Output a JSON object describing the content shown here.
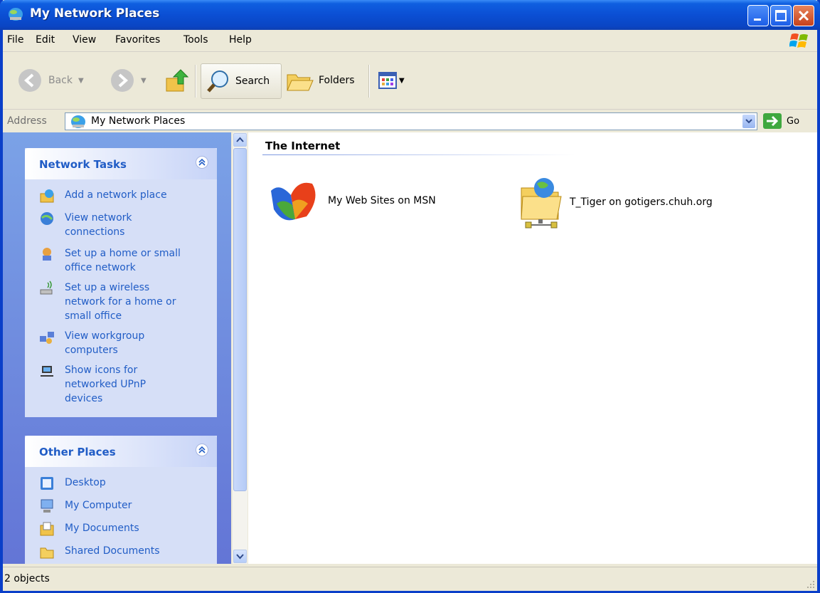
{
  "window": {
    "title": "My Network Places"
  },
  "menu": [
    "File",
    "Edit",
    "View",
    "Favorites",
    "Tools",
    "Help"
  ],
  "toolbar": {
    "back": "Back",
    "search": "Search",
    "folders": "Folders"
  },
  "address": {
    "label": "Address",
    "value": "My Network Places",
    "go": "Go"
  },
  "network_tasks": {
    "title": "Network Tasks",
    "items": [
      {
        "label": "Add a network place",
        "icon": "add-network-place-icon"
      },
      {
        "label": "View network connections",
        "icon": "network-connections-icon"
      },
      {
        "label": "Set up a home or small office network",
        "icon": "home-network-icon"
      },
      {
        "label": "Set up a wireless network for a home or small office",
        "icon": "wireless-network-icon"
      },
      {
        "label": "View workgroup computers",
        "icon": "workgroup-icon"
      },
      {
        "label": "Show icons for networked UPnP devices",
        "icon": "upnp-icon"
      }
    ]
  },
  "other_places": {
    "title": "Other Places",
    "items": [
      {
        "label": "Desktop",
        "icon": "desktop-icon"
      },
      {
        "label": "My Computer",
        "icon": "my-computer-icon"
      },
      {
        "label": "My Documents",
        "icon": "my-documents-icon"
      },
      {
        "label": "Shared Documents",
        "icon": "shared-documents-icon"
      }
    ]
  },
  "content": {
    "group": "The Internet",
    "items": [
      {
        "label": "My Web Sites on MSN",
        "icon": "msn-butterfly-icon"
      },
      {
        "label": "T_Tiger on gotigers.chuh.org",
        "icon": "network-folder-icon"
      }
    ]
  },
  "status": {
    "text": "2 objects"
  },
  "colors": {
    "titlebar": "#0b4fd4",
    "task_link": "#215dc6",
    "sidebar": "#6d8ee0"
  }
}
